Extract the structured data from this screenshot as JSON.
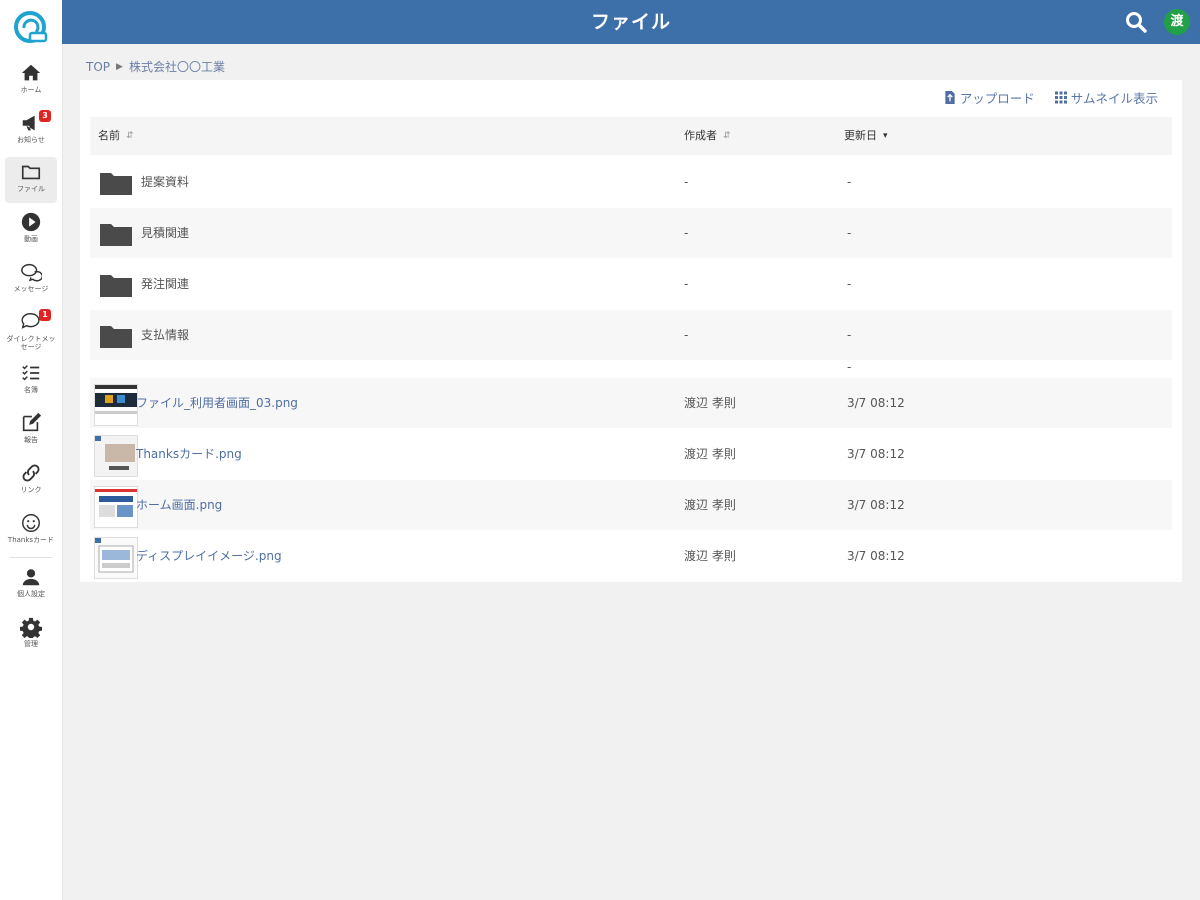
{
  "header": {
    "title": "ファイル",
    "avatar_initial": "渡"
  },
  "sidebar": {
    "items": [
      {
        "label": "ホーム"
      },
      {
        "label": "お知らせ",
        "badge": "3"
      },
      {
        "label": "ファイル"
      },
      {
        "label": "動画"
      },
      {
        "label": "メッセージ"
      },
      {
        "label": "ダイレクトメッセージ",
        "badge": "1"
      },
      {
        "label": "名簿"
      },
      {
        "label": "報告"
      },
      {
        "label": "リンク"
      },
      {
        "label": "Thanksカード"
      },
      {
        "label": "個人設定"
      },
      {
        "label": "管理"
      }
    ]
  },
  "breadcrumb": {
    "root": "TOP",
    "current": "株式会社〇〇工業"
  },
  "toolbar": {
    "upload": "アップロード",
    "thumbnail": "サムネイル表示"
  },
  "table": {
    "columns": {
      "name": "名前",
      "creator": "作成者",
      "updated": "更新日"
    },
    "folders": [
      {
        "name": "提案資料",
        "creator": "-",
        "updated": "-"
      },
      {
        "name": "見積関連",
        "creator": "-",
        "updated": "-"
      },
      {
        "name": "発注関連",
        "creator": "-",
        "updated": "-"
      },
      {
        "name": "支払情報",
        "creator": "-",
        "updated": "-"
      }
    ],
    "stray_dash": "-",
    "files": [
      {
        "name": "ファイル_利用者画面_03.png",
        "creator": "渡辺 孝則",
        "updated": "3/7 08:12"
      },
      {
        "name": "Thanksカード.png",
        "creator": "渡辺 孝則",
        "updated": "3/7 08:12"
      },
      {
        "name": "ホーム画面.png",
        "creator": "渡辺 孝則",
        "updated": "3/7 08:12"
      },
      {
        "name": "ディスプレイイメージ.png",
        "creator": "渡辺 孝則",
        "updated": "3/7 08:12"
      }
    ]
  },
  "colors": {
    "header": "#3d6fa9",
    "link": "#4f6ea3",
    "badge": "#e02424",
    "avatar": "#21a047"
  }
}
